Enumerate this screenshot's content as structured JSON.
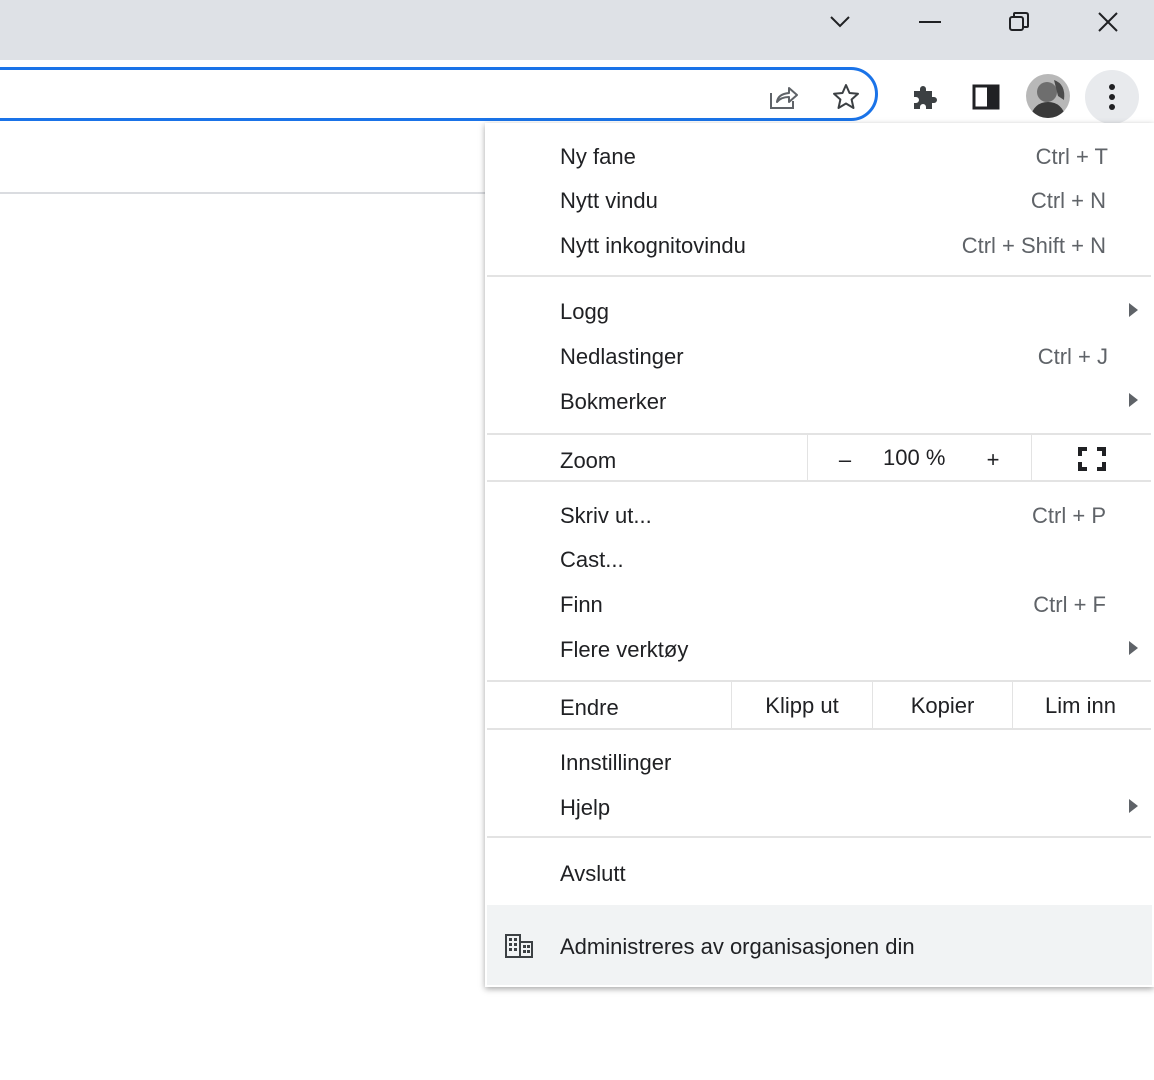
{
  "window": {
    "controls": {
      "tab_search_icon": "chevron-down-icon",
      "minimize_icon": "minimize-icon",
      "restore_icon": "restore-icon",
      "close_icon": "close-icon"
    }
  },
  "toolbar": {
    "accent": "#1a73e8",
    "icons": [
      "share-icon",
      "star-icon",
      "extensions-icon",
      "side-panel-icon",
      "avatar",
      "menu-icon"
    ]
  },
  "menu": {
    "new_tab": {
      "label": "Ny fane",
      "shortcut": "Ctrl + T"
    },
    "new_window": {
      "label": "Nytt vindu",
      "shortcut": "Ctrl + N"
    },
    "new_incognito": {
      "label": "Nytt inkognitovindu",
      "shortcut": "Ctrl + Shift + N"
    },
    "history": {
      "label": "Logg"
    },
    "downloads": {
      "label": "Nedlastinger",
      "shortcut": "Ctrl + J"
    },
    "bookmarks": {
      "label": "Bokmerker"
    },
    "zoom": {
      "label": "Zoom",
      "minus": "–",
      "value": "100 %",
      "plus": "+"
    },
    "print": {
      "label": "Skriv ut...",
      "shortcut": "Ctrl + P"
    },
    "cast": {
      "label": "Cast..."
    },
    "find": {
      "label": "Finn",
      "shortcut": "Ctrl + F"
    },
    "more_tools": {
      "label": "Flere verktøy"
    },
    "edit": {
      "label": "Endre",
      "cut": "Klipp ut",
      "copy": "Kopier",
      "paste": "Lim inn"
    },
    "settings": {
      "label": "Innstillinger"
    },
    "help": {
      "label": "Hjelp"
    },
    "exit": {
      "label": "Avslutt"
    },
    "managed": {
      "label": "Administreres av organisasjonen din",
      "icon": "building-icon"
    }
  }
}
